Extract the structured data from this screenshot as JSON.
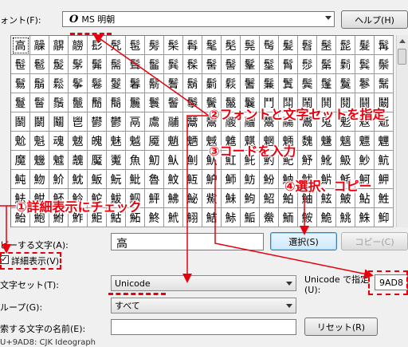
{
  "top": {
    "font_label": "ォント(F):",
    "font_value": "MS 明朝",
    "help_button": "ヘルプ(H)"
  },
  "grid": {
    "selected_index": 0,
    "cells": [
      "高",
      "髞",
      "髜",
      "髝",
      "髟",
      "髠",
      "髢",
      "髣",
      "髤",
      "髥",
      "髦",
      "髧",
      "髨",
      "髩",
      "髪",
      "髫",
      "髬",
      "髭",
      "髮",
      "髯",
      "髰",
      "髱",
      "髲",
      "髳",
      "髴",
      "髵",
      "髶",
      "髷",
      "髸",
      "髹",
      "髺",
      "髻",
      "髼",
      "髽",
      "髾",
      "髿",
      "鬀",
      "鬁",
      "鬂",
      "鬃",
      "鬄",
      "鬅",
      "鬆",
      "鬇",
      "鬈",
      "鬉",
      "鬊",
      "鬋",
      "鬌",
      "鬍",
      "鬎",
      "鬏",
      "鬐",
      "鬑",
      "鬒",
      "鬓",
      "鬔",
      "鬕",
      "鬖",
      "鬗",
      "鬘",
      "鬙",
      "鬚",
      "鬛",
      "鬜",
      "鬝",
      "鬞",
      "鬟",
      "鬠",
      "鬡",
      "鬢",
      "鬣",
      "鬤",
      "鬥",
      "鬦",
      "鬧",
      "鬨",
      "鬩",
      "鬪",
      "鬫",
      "鬬",
      "鬭",
      "鬮",
      "鬯",
      "鬰",
      "鬱",
      "鬲",
      "鬳",
      "鬴",
      "鬵",
      "鬶",
      "鬷",
      "鬸",
      "鬹",
      "鬺",
      "鬻",
      "鬼",
      "鬽",
      "鬾",
      "鬿",
      "魀",
      "魁",
      "魂",
      "魃",
      "魄",
      "魅",
      "魆",
      "魇",
      "魈",
      "魉",
      "魊",
      "魋",
      "魌",
      "魍",
      "魎",
      "魏",
      "魐",
      "魑",
      "魒",
      "魓",
      "魔",
      "魕",
      "魖",
      "魗",
      "魘",
      "魙",
      "魚",
      "魛",
      "魜",
      "魝",
      "魞",
      "魟",
      "魠",
      "魡",
      "魢",
      "魣",
      "魤",
      "魥",
      "魦",
      "魧",
      "魨",
      "魩",
      "魪",
      "魫",
      "魬",
      "魭",
      "魮",
      "魯",
      "魰",
      "魱",
      "魲",
      "魳",
      "魴",
      "魵",
      "魶",
      "魷",
      "魸",
      "魹",
      "魺",
      "魻",
      "魼",
      "魽",
      "魾",
      "魿",
      "鮀",
      "鮁",
      "鮂",
      "鮃",
      "鮄",
      "鮅",
      "鮆",
      "鮇",
      "鮈",
      "鮉",
      "鮊",
      "鮋",
      "鮌",
      "鮍",
      "鮎",
      "鮏",
      "鮐",
      "鮑",
      "鮒",
      "鮓",
      "鮔",
      "鮕",
      "鮖",
      "鮗",
      "鮘",
      "鮙",
      "鮚",
      "鮛",
      "鮜",
      "鮝",
      "鮞",
      "鮟",
      "鮠",
      "鮡",
      "鮢",
      "鮣"
    ]
  },
  "copy": {
    "label": "ピーする文字(A):",
    "value": "高",
    "select_button": "選択(S)",
    "copy_button": "コピー(C)"
  },
  "advanced": {
    "checkbox_label": "詳細表示(V)",
    "checked": true,
    "check_mark": "✓"
  },
  "charset": {
    "label": "文字セット(T):",
    "value": "Unicode",
    "unicode_label_line1": "Unicode で指定",
    "unicode_label_line2": "(U):",
    "unicode_value": "9AD8"
  },
  "group": {
    "label": "ループ(G):",
    "value": "すべて"
  },
  "search": {
    "label": "索する文字の名前(E):",
    "value": "",
    "reset_button": "リセット(R)"
  },
  "status": {
    "text": "U+9AD8: CJK Ideograph"
  },
  "annotations": {
    "a1": "①詳細表示にチェック",
    "a2": "②フォントと文字セットを指定",
    "a3": "③コードを入力",
    "a4": "④選択、コピー",
    "color": "#e8000d"
  }
}
